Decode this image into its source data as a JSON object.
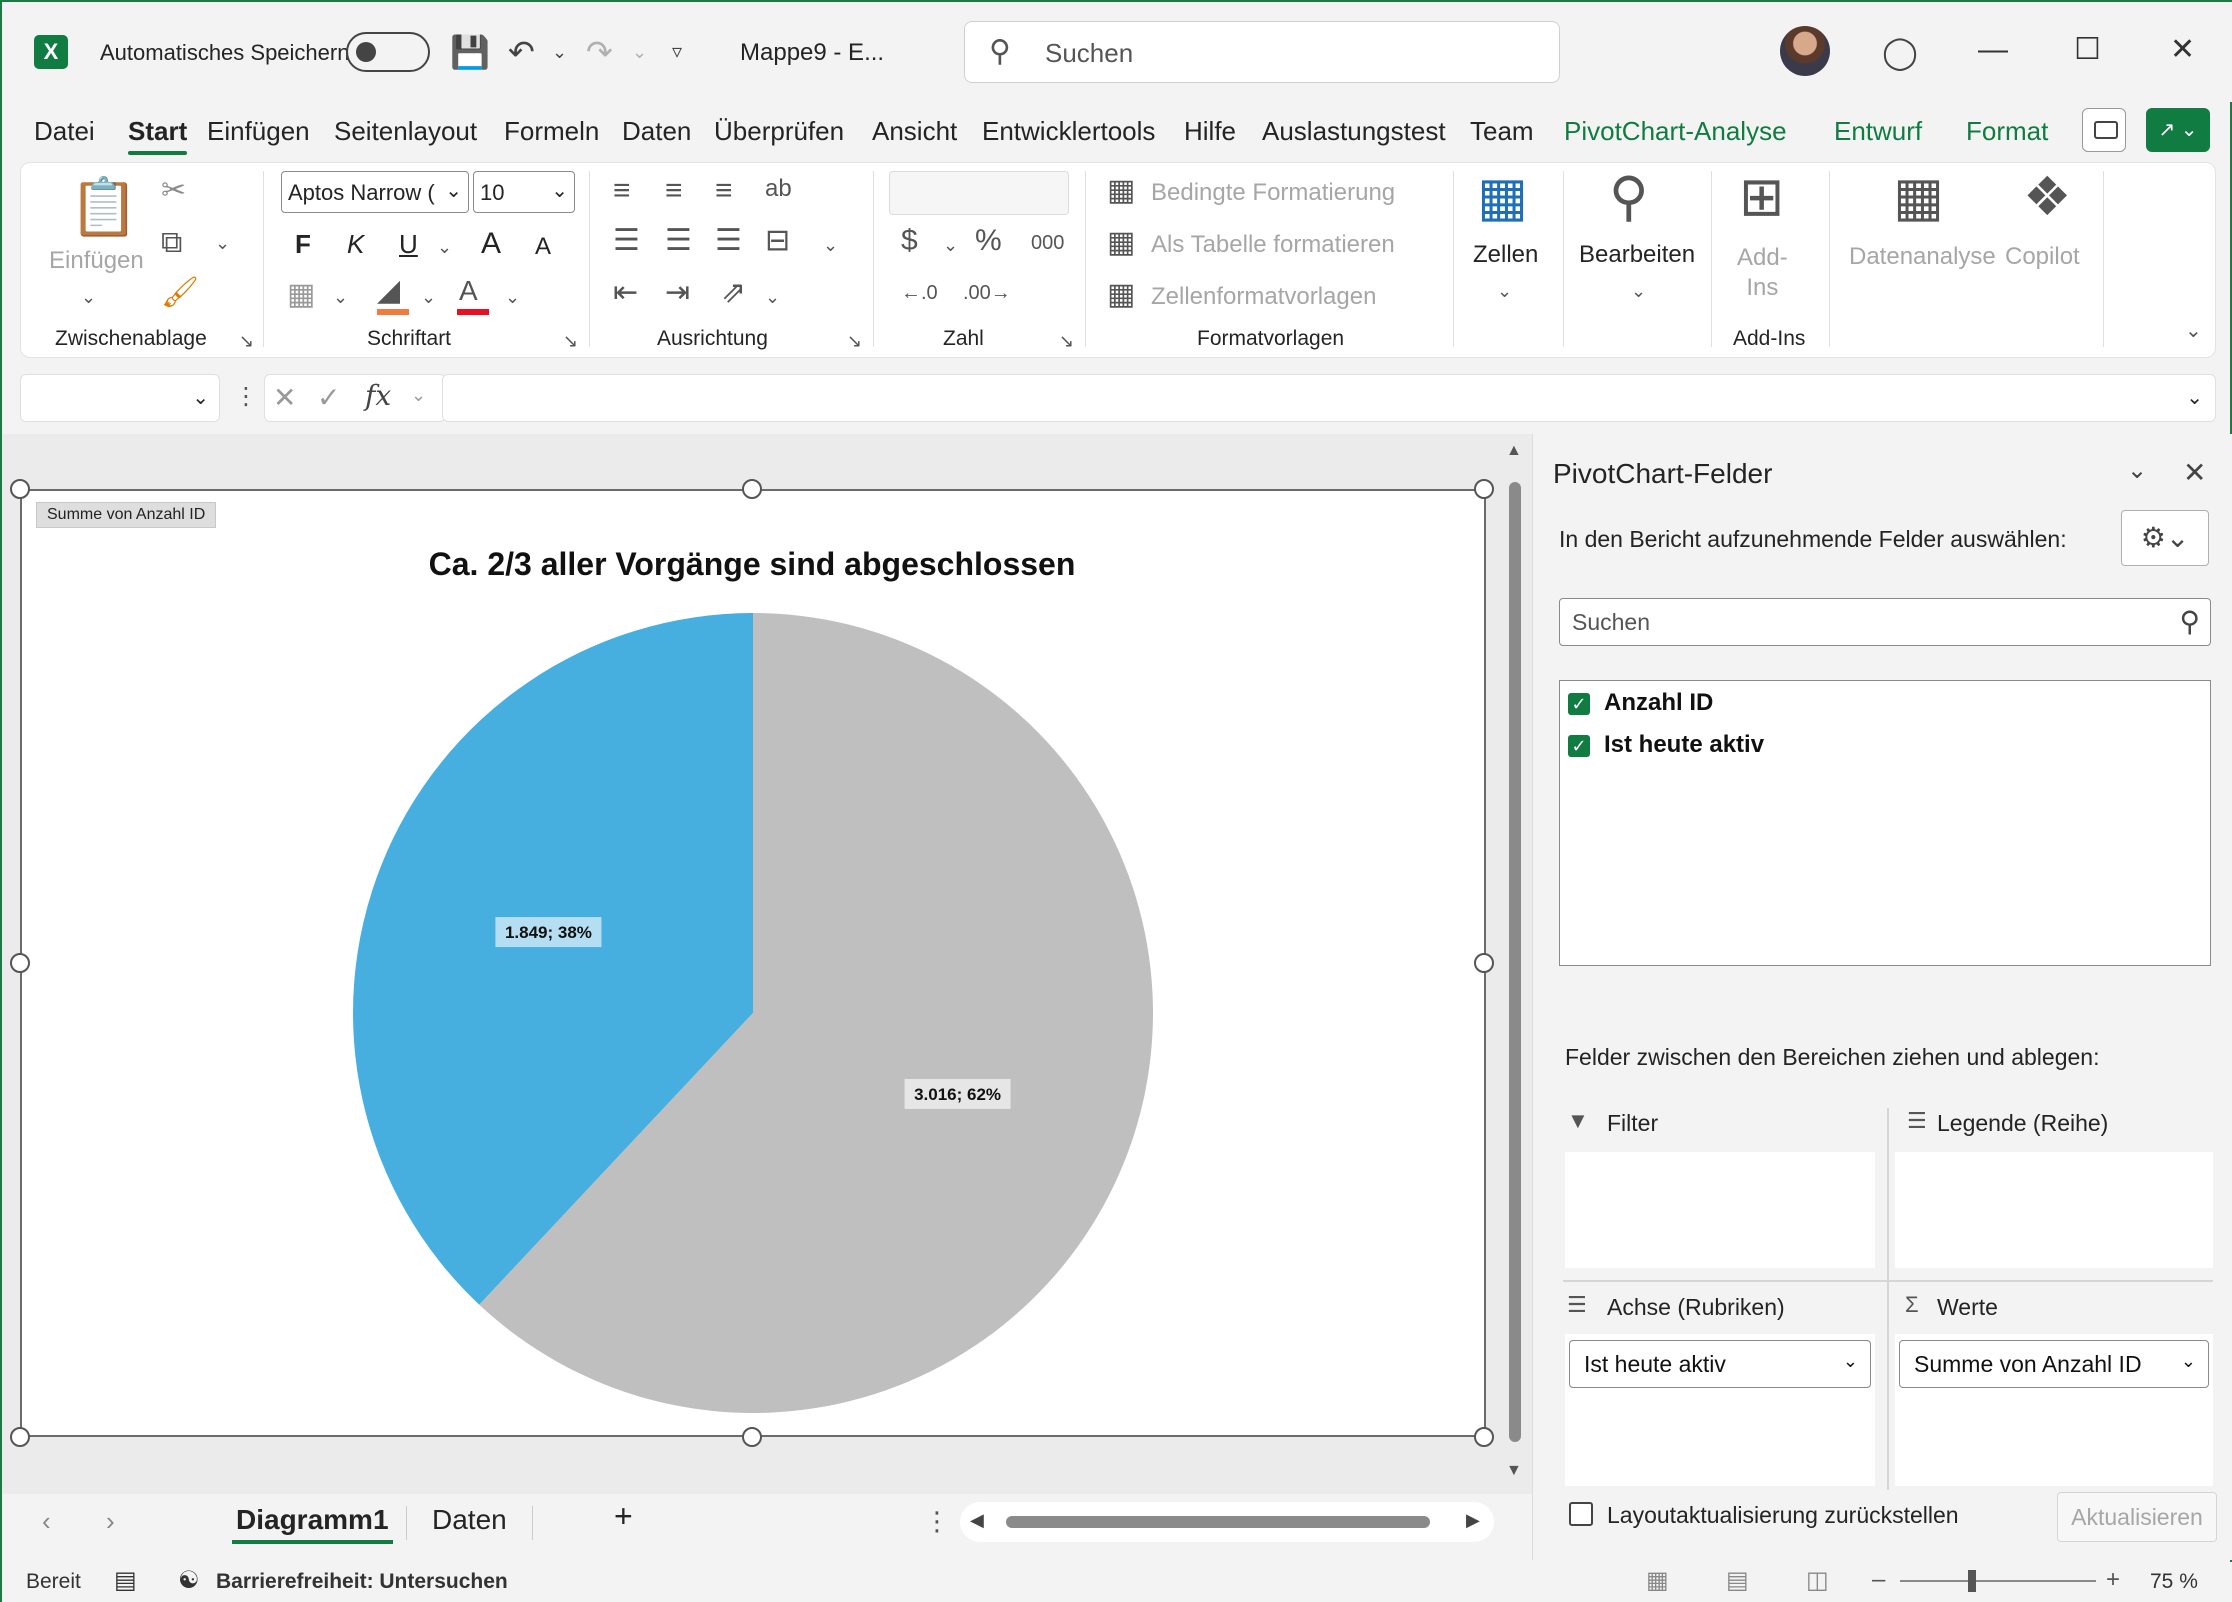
{
  "app": {
    "logo": "X",
    "autosave_label": "Automatisches Speichern",
    "doc_title": "Mappe9  -  E...",
    "search_placeholder": "Suchen"
  },
  "menu": {
    "tabs": [
      "Datei",
      "Start",
      "Einfügen",
      "Seitenlayout",
      "Formeln",
      "Daten",
      "Überprüfen",
      "Ansicht",
      "Entwicklertools",
      "Hilfe",
      "Auslastungstest",
      "Team",
      "PivotChart-Analyse",
      "Entwurf",
      "Format"
    ],
    "active": "Start",
    "contextual": [
      "PivotChart-Analyse",
      "Entwurf",
      "Format"
    ]
  },
  "ribbon": {
    "clipboard": {
      "paste": "Einfügen",
      "label": "Zwischenablage"
    },
    "font": {
      "name": "Aptos Narrow (",
      "size": "10",
      "bold": "F",
      "italic": "K",
      "underline": "U",
      "grow": "A",
      "shrink": "A",
      "label": "Schriftart"
    },
    "alignment": {
      "label": "Ausrichtung"
    },
    "number": {
      "currency": "$",
      "percent": "%",
      "thousands": "000",
      "label": "Zahl"
    },
    "styles": {
      "conditional": "Bedingte Formatierung",
      "table": "Als Tabelle formatieren",
      "cell_styles": "Zellenformatvorlagen",
      "label": "Formatvorlagen"
    },
    "cells": {
      "label": "Zellen"
    },
    "editing": {
      "label": "Bearbeiten"
    },
    "addins": {
      "button": "Add-\nIns",
      "label": "Add-Ins"
    },
    "data_analysis": "Datenanalyse",
    "copilot": "Copilot"
  },
  "formula_bar": {
    "fx": "fx"
  },
  "chart": {
    "field_button": "Summe von Anzahl ID",
    "colors": {
      "blue": "#47afe0",
      "gray": "#bfbfbf"
    }
  },
  "chart_data": {
    "type": "pie",
    "title": "Ca. 2/3 aller Vorgänge sind abgeschlossen",
    "slices": [
      {
        "value": 1849,
        "percent": 38,
        "label": "1.849; 38%",
        "color": "#47afe0"
      },
      {
        "value": 3016,
        "percent": 62,
        "label": "3.016; 62%",
        "color": "#bfbfbf"
      }
    ]
  },
  "sheets": {
    "tabs": [
      "Diagramm1",
      "Daten"
    ],
    "active": "Diagramm1",
    "add": "+"
  },
  "status": {
    "ready": "Bereit",
    "accessibility": "Barrierefreiheit: Untersuchen",
    "zoom": "75 %"
  },
  "panel": {
    "title": "PivotChart-Felder",
    "subtitle": "In den Bericht aufzunehmende Felder auswählen:",
    "search_placeholder": "Suchen",
    "fields": [
      {
        "name": "Anzahl ID",
        "checked": true
      },
      {
        "name": "Ist heute aktiv",
        "checked": true
      }
    ],
    "drag_hint": "Felder zwischen den Bereichen ziehen und ablegen:",
    "areas": {
      "filter": "Filter",
      "legend": "Legende (Reihe)",
      "axis": "Achse (Rubriken)",
      "values": "Werte",
      "axis_item": "Ist heute aktiv",
      "values_item": "Summe von Anzahl ID"
    },
    "defer_label": "Layoutaktualisierung zurückstellen",
    "update_button": "Aktualisieren"
  }
}
